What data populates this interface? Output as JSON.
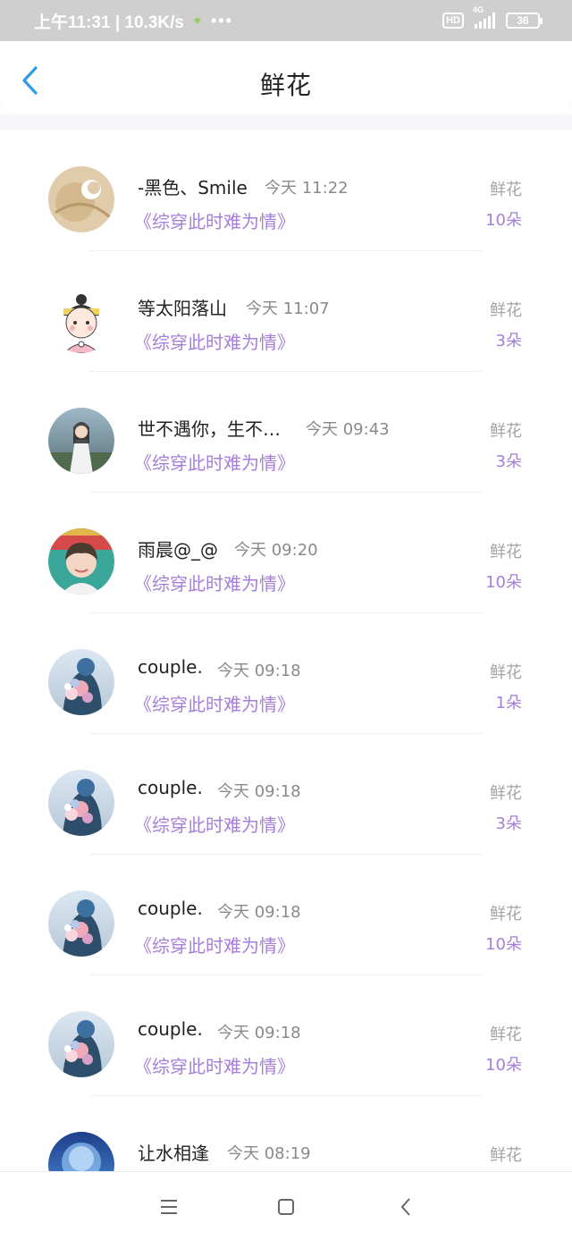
{
  "status_bar": {
    "time_speed": "上午11:31 | 10.3K/s",
    "dots": "•••",
    "hd": "HD",
    "network": "4G",
    "battery": "36"
  },
  "header": {
    "title": "鲜花"
  },
  "rows": [
    {
      "name": "-黑色、Smile",
      "time": "今天 11:22",
      "book": "《综穿此时难为情》",
      "kind": "鲜花",
      "count": "10朵",
      "avatar": "sand"
    },
    {
      "name": "等太阳落山",
      "time": "今天 11:07",
      "book": "《综穿此时难为情》",
      "kind": "鲜花",
      "count": "3朵",
      "avatar": "cartoon"
    },
    {
      "name": "世不遇你，生不…",
      "time": "今天 09:43",
      "book": "《综穿此时难为情》",
      "kind": "鲜花",
      "count": "3朵",
      "avatar": "costume"
    },
    {
      "name": "雨晨@_@",
      "time": "今天 09:20",
      "book": "《综穿此时难为情》",
      "kind": "鲜花",
      "count": "10朵",
      "avatar": "portrait"
    },
    {
      "name": "couple.",
      "time": "今天 09:18",
      "book": "《综穿此时难为情》",
      "kind": "鲜花",
      "count": "1朵",
      "avatar": "flowers"
    },
    {
      "name": "couple.",
      "time": "今天 09:18",
      "book": "《综穿此时难为情》",
      "kind": "鲜花",
      "count": "3朵",
      "avatar": "flowers"
    },
    {
      "name": "couple.",
      "time": "今天 09:18",
      "book": "《综穿此时难为情》",
      "kind": "鲜花",
      "count": "10朵",
      "avatar": "flowers"
    },
    {
      "name": "couple.",
      "time": "今天 09:18",
      "book": "《综穿此时难为情》",
      "kind": "鲜花",
      "count": "10朵",
      "avatar": "flowers"
    },
    {
      "name": "让水相逢",
      "time": "今天 08:19",
      "book": "",
      "kind": "鲜花",
      "count": "",
      "avatar": "tree"
    }
  ],
  "colors": {
    "accent_blue": "#2f9be8",
    "book_purple": "#a67fd7",
    "muted": "#8a8a8a"
  },
  "icons": {
    "back": "chevron-left-icon",
    "nav_menu": "menu-icon",
    "nav_home": "square-icon",
    "nav_back": "chevron-left-icon"
  }
}
